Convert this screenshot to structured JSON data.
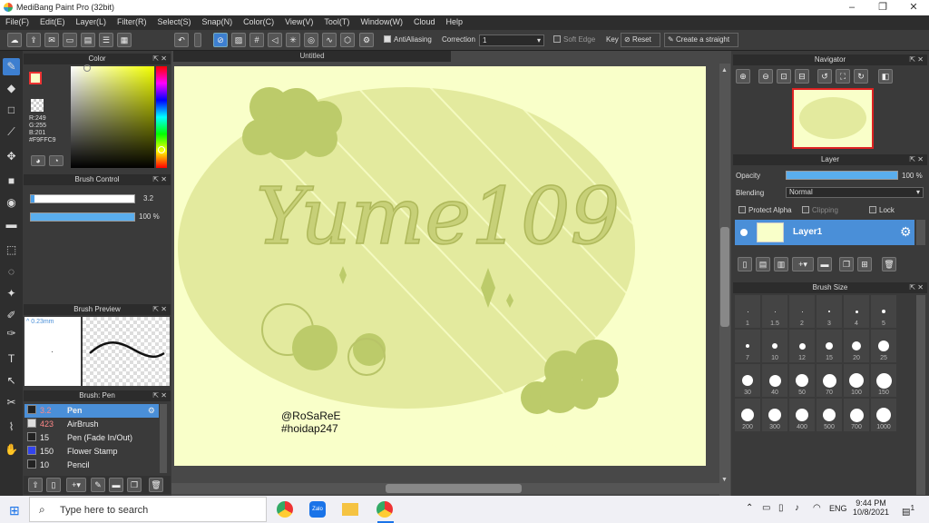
{
  "window": {
    "title": "MediBang Paint Pro (32bit)"
  },
  "menu": [
    "File(F)",
    "Edit(E)",
    "Layer(L)",
    "Filter(R)",
    "Select(S)",
    "Snap(N)",
    "Color(C)",
    "View(V)",
    "Tool(T)",
    "Window(W)",
    "Cloud",
    "Help"
  ],
  "toolbar": {
    "antialiasing": "AntiAliasing",
    "correction_label": "Correction",
    "correction_value": "1",
    "soft_edge": "Soft Edge",
    "key": "Key",
    "reset": "Reset",
    "straight": "Create a straight"
  },
  "canvas": {
    "tab": "Untitled",
    "artwork_text": "Yume109",
    "watermark_line1": "@RoSaReE",
    "watermark_line2": "#hoidap247"
  },
  "color_panel": {
    "title": "Color",
    "r": "R:249",
    "g": "G:255",
    "b": "B:201",
    "hex": "#F9FFC9",
    "fg": "#F9FFC9",
    "bg": "#ffffff"
  },
  "brush_control": {
    "title": "Brush Control",
    "size": "3.2",
    "opacity": "100 %"
  },
  "brush_preview": {
    "title": "Brush Preview",
    "size": "^ 0.23mm"
  },
  "brush_list": {
    "title": "Brush: Pen",
    "items": [
      {
        "size": "3.2",
        "name": "Pen",
        "color": "#222222"
      },
      {
        "size": "423",
        "name": "AirBrush",
        "color": "#dddddd"
      },
      {
        "size": "15",
        "name": "Pen (Fade In/Out)",
        "color": "#222222"
      },
      {
        "size": "150",
        "name": "Flower Stamp",
        "color": "#3344ee"
      },
      {
        "size": "10",
        "name": "Pencil",
        "color": "#222222"
      }
    ]
  },
  "navigator": {
    "title": "Navigator"
  },
  "layer_panel": {
    "title": "Layer",
    "opacity_label": "Opacity",
    "opacity_value": "100 %",
    "opacity_fraction": 1.0,
    "blending_label": "Blending",
    "blending_value": "Normal",
    "protect_alpha": "Protect Alpha",
    "clipping": "Clipping",
    "lock": "Lock",
    "layer_name": "Layer1"
  },
  "brush_size": {
    "title": "Brush Size",
    "sizes": [
      "1",
      "1.5",
      "2",
      "3",
      "4",
      "5",
      "7",
      "10",
      "12",
      "15",
      "20",
      "25",
      "30",
      "40",
      "50",
      "70",
      "100",
      "150",
      "200",
      "300",
      "400",
      "500",
      "700",
      "1000"
    ]
  },
  "taskbar": {
    "search_placeholder": "Type here to search",
    "lang": "ENG",
    "time": "9:44 PM",
    "date": "10/8/2021",
    "notif": "1"
  }
}
